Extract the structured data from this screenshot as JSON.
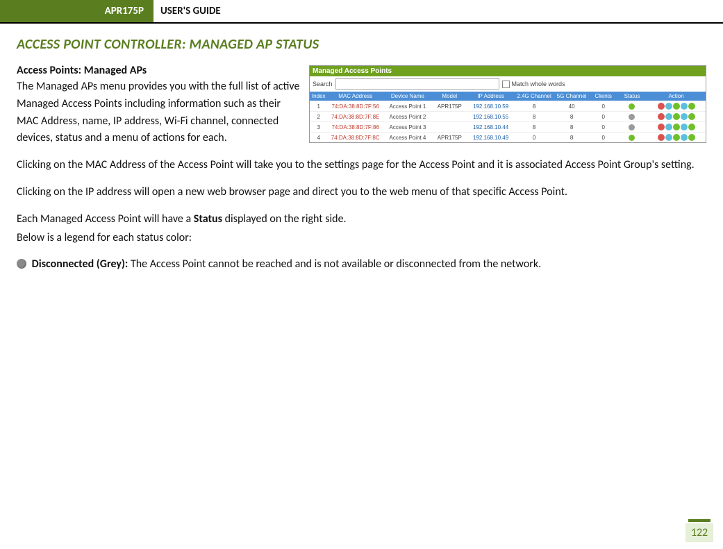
{
  "header": {
    "model": "APR175P",
    "title": "USER'S GUIDE"
  },
  "section": {
    "title": "ACCESS POINT CONTROLLER: MANAGED AP STATUS"
  },
  "sub": {
    "title": "Access Points: Managed APs"
  },
  "para": {
    "intro": "The Managed APs menu provides you with the full list of active Managed Access Points including information such as their MAC Address, name, IP address, Wi-Fi channel, connected devices, status and a menu of actions for each.",
    "mac_click": "Clicking on the MAC Address of the Access Point will take you to the settings page for the Access Point and it is associated Access Point Group's setting.",
    "ip_click": "Clicking on the IP address will open a new web browser page and direct you to the web menu of that specific Access Point.",
    "status_1a": "Each Managed Access Point will have a ",
    "status_1b": "Status",
    "status_1c": " displayed on the right side.",
    "status_2": "Below is a legend for each status color:",
    "grey_a": "Disconnected (Grey): ",
    "grey_b": "The Access Point cannot be reached and is not available or disconnected from the network."
  },
  "screenshot": {
    "title": "Managed Access Points",
    "search_label": "Search",
    "search_placeholder": "",
    "match_label": "Match whole words",
    "cols": {
      "index": "Index",
      "mac": "MAC Address",
      "name": "Device Name",
      "model": "Model",
      "ip": "IP Address",
      "ch24": "2.4G Channel",
      "ch5": "5G Channel",
      "clients": "Clients",
      "status": "Status",
      "action": "Action"
    },
    "rows": [
      {
        "index": "1",
        "mac": "74:DA:38:8D:7F:56",
        "name": "Access Point 1",
        "model": "APR175P",
        "ip": "192.168.10.59",
        "ch24": "8",
        "ch5": "40",
        "clients": "0",
        "status": "green"
      },
      {
        "index": "2",
        "mac": "74:DA:38:8D:7F:8E",
        "name": "Access Point 2",
        "model": "",
        "ip": "192.168.10.55",
        "ch24": "8",
        "ch5": "8",
        "clients": "0",
        "status": "grey"
      },
      {
        "index": "3",
        "mac": "74:DA:38:8D:7F:86",
        "name": "Access Point 3",
        "model": "",
        "ip": "192.168.10.44",
        "ch24": "8",
        "ch5": "8",
        "clients": "0",
        "status": "grey"
      },
      {
        "index": "4",
        "mac": "74:DA:38:8D:7F:8C",
        "name": "Access Point 4",
        "model": "APR175P",
        "ip": "192.168.10.49",
        "ch24": "0",
        "ch5": "8",
        "clients": "0",
        "status": "green"
      }
    ]
  },
  "footer": {
    "page": "122"
  }
}
